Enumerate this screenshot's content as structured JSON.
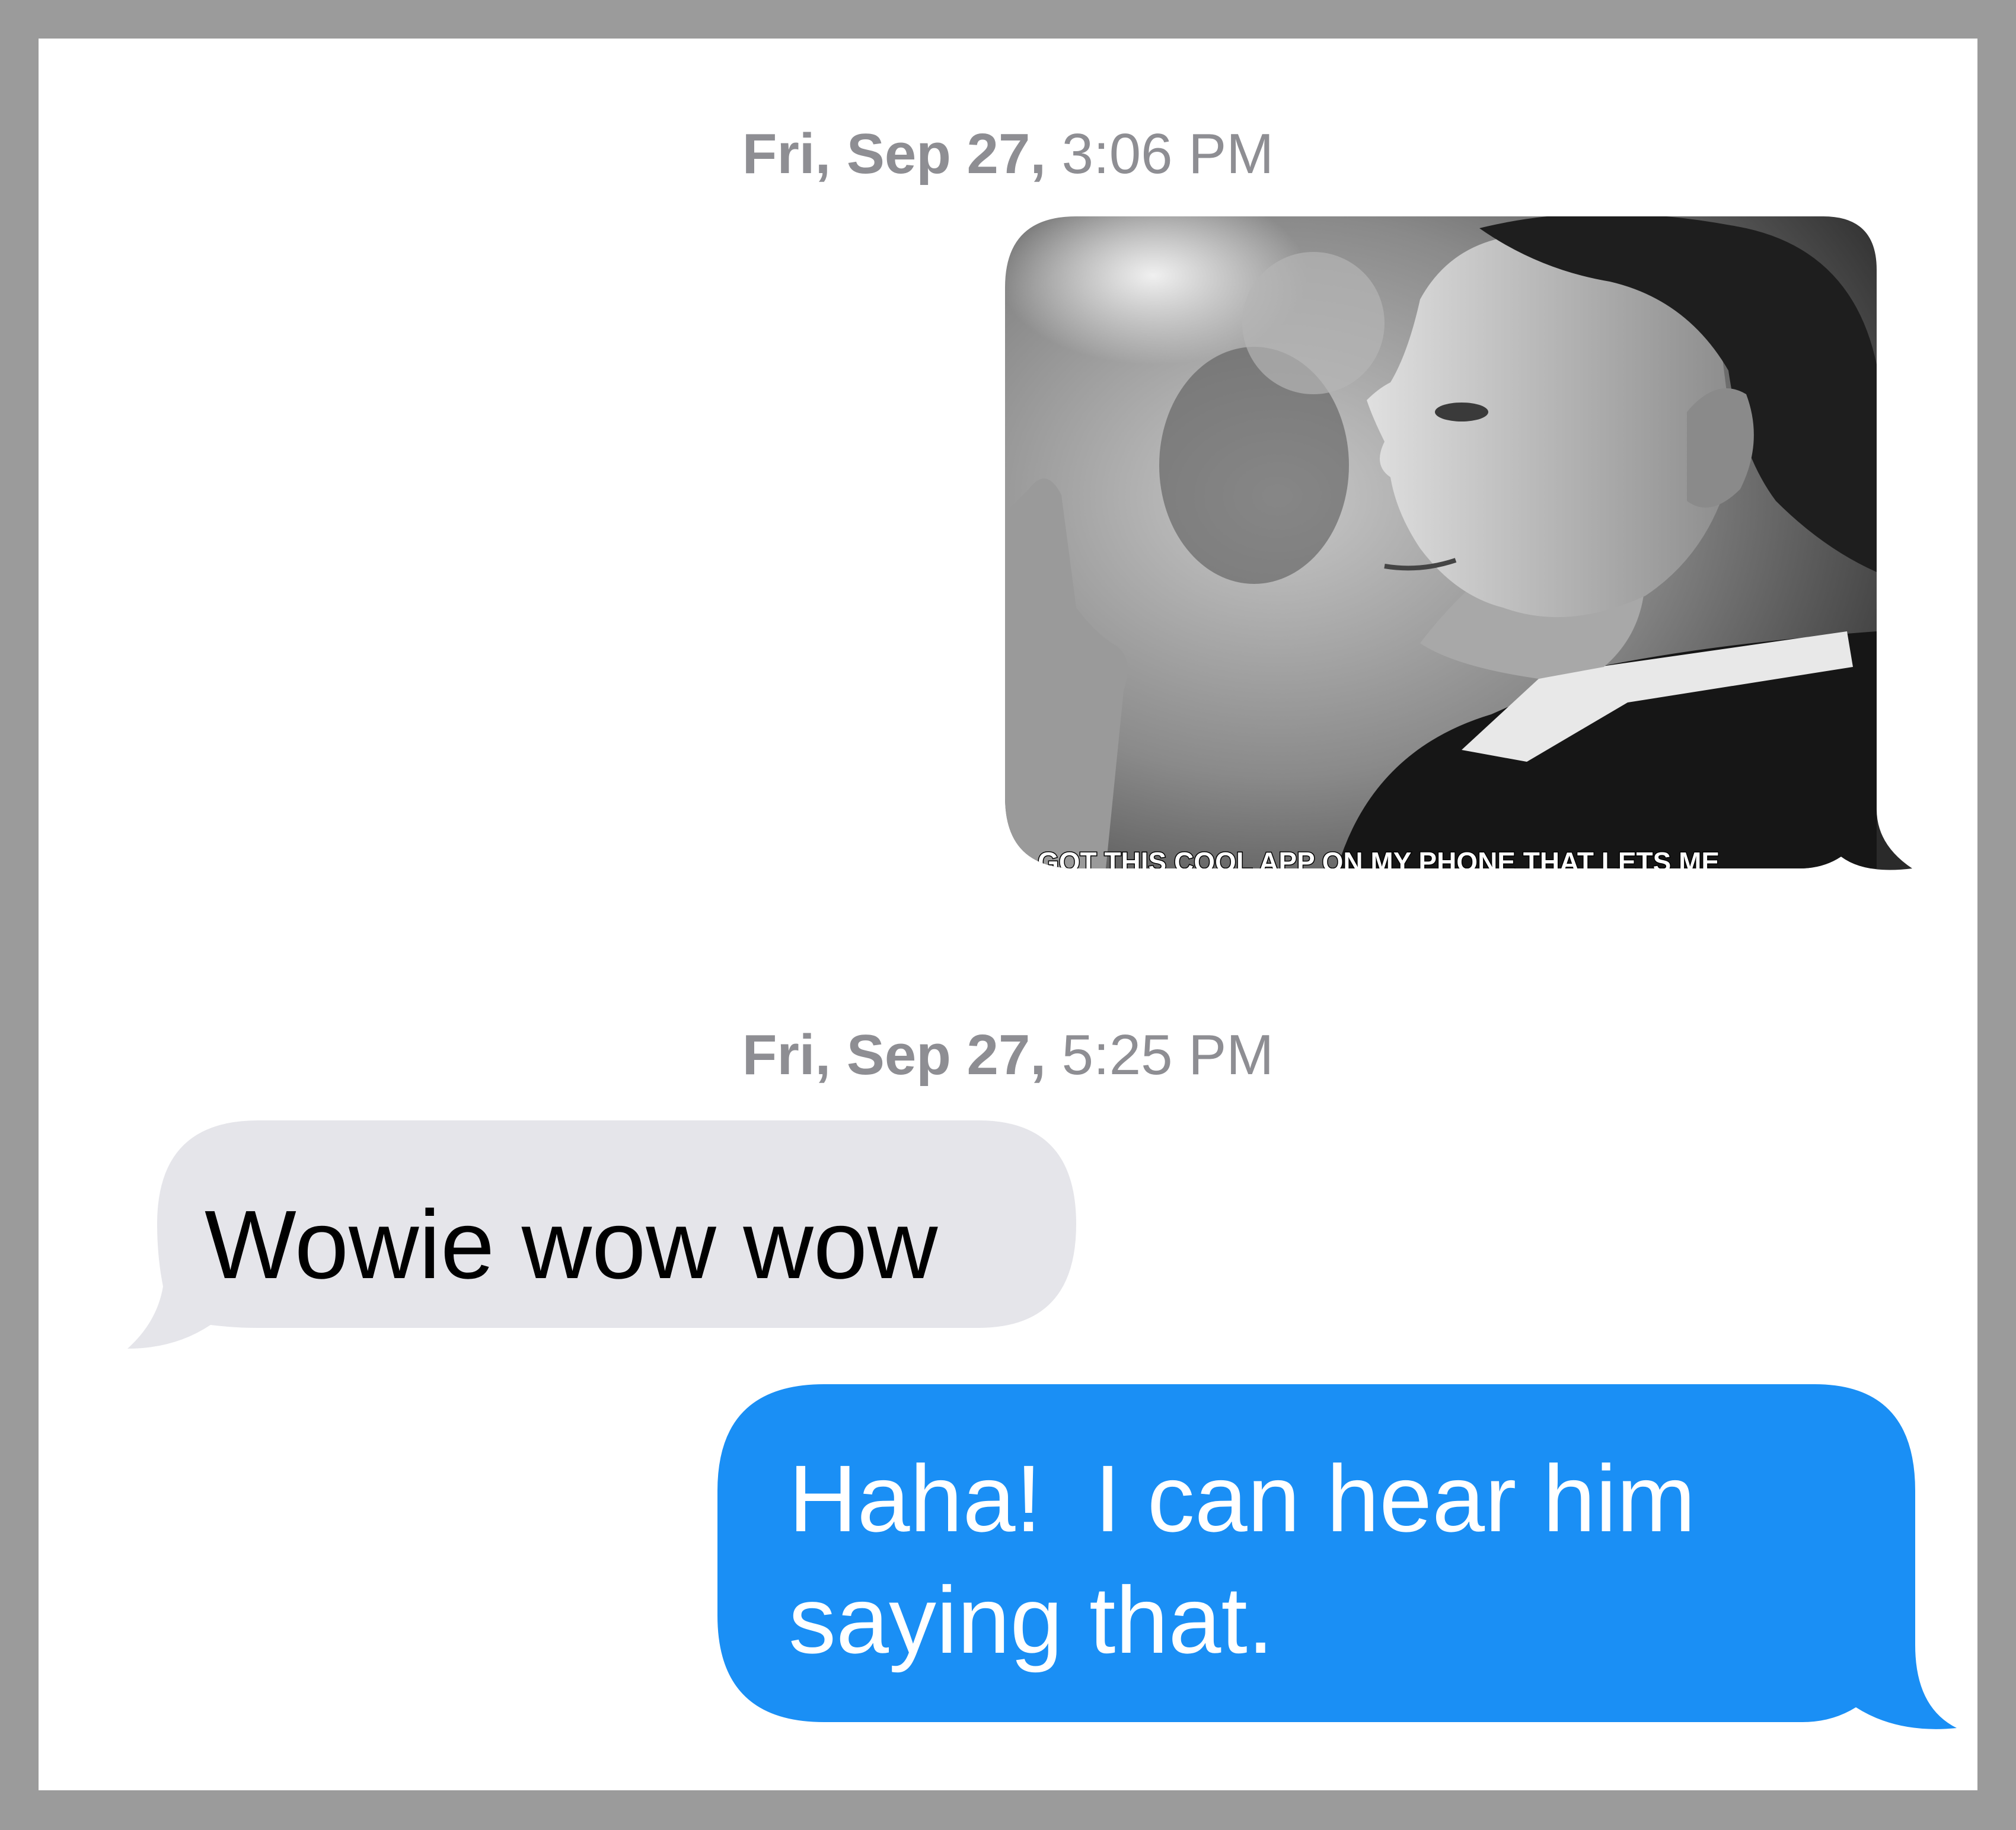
{
  "conversation": {
    "timestamps": [
      {
        "day": "Fri, Sep 27,",
        "time": "3:06 PM"
      },
      {
        "day": "Fri, Sep 27,",
        "time": "5:25 PM"
      }
    ],
    "image_message": {
      "caption": "GOT THIS COOL APP ON MY PHONE THAT LETS ME"
    },
    "received_message": {
      "text": "Wowie wow wow"
    },
    "sent_message": {
      "line1": "Haha!  I can hear him",
      "line2": "saying that."
    }
  },
  "colors": {
    "sent_bubble": "#1a8ff5",
    "received_bubble": "#e5e5ea",
    "timestamp": "#8e8e93",
    "background": "#ffffff",
    "border": "#9b9b9b"
  }
}
